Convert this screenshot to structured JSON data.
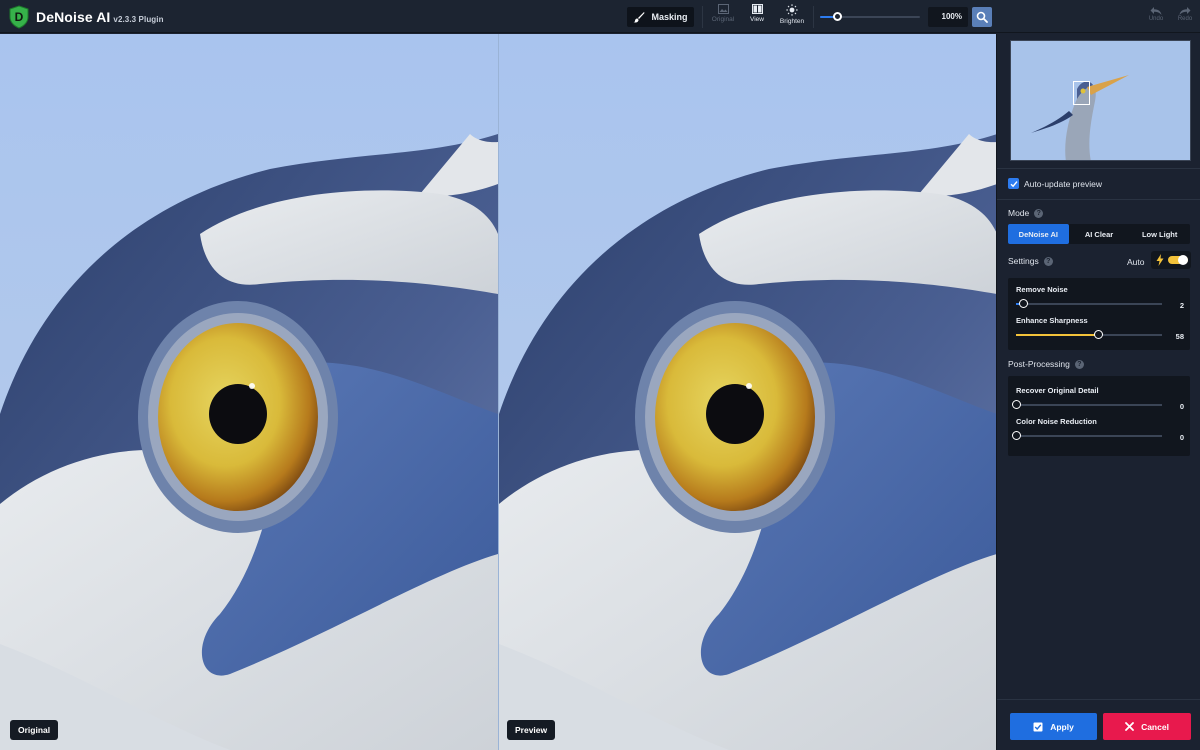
{
  "app": {
    "name": "DeNoise AI",
    "version": "v2.3.3 Plugin",
    "logo_letter": "D",
    "accent_color": "#2d7cf0"
  },
  "toolbar": {
    "masking_label": "Masking",
    "original_label": "Original",
    "view_label": "View",
    "brighten_label": "Brighten",
    "zoom_value": "100%",
    "zoom_slider_level": 0.17,
    "undo_label": "Undo",
    "redo_label": "Redo"
  },
  "canvas": {
    "original_label": "Original",
    "preview_label": "Preview"
  },
  "panel": {
    "auto_update_label": "Auto-update preview",
    "auto_update_checked": true,
    "mode": {
      "title": "Mode",
      "options": [
        "DeNoise AI",
        "AI Clear",
        "Low Light"
      ],
      "selected": "DeNoise AI"
    },
    "settings": {
      "title": "Settings",
      "auto_label": "Auto",
      "auto_enabled": true,
      "sliders": [
        {
          "label": "Remove Noise",
          "value": "2",
          "level": 0.05,
          "fill_color": "#2d7cf0"
        },
        {
          "label": "Enhance Sharpness",
          "value": "58",
          "level": 0.56,
          "fill_color": "#f3c23a"
        }
      ]
    },
    "post_processing": {
      "title": "Post-Processing",
      "sliders": [
        {
          "label": "Recover Original Detail",
          "value": "0",
          "level": 0.0,
          "fill_color": "#2d7cf0"
        },
        {
          "label": "Color Noise Reduction",
          "value": "0",
          "level": 0.0,
          "fill_color": "#2d7cf0"
        }
      ]
    },
    "apply_label": "Apply",
    "cancel_label": "Cancel",
    "apply_color": "#1f6ee0",
    "cancel_color": "#e8194d"
  }
}
